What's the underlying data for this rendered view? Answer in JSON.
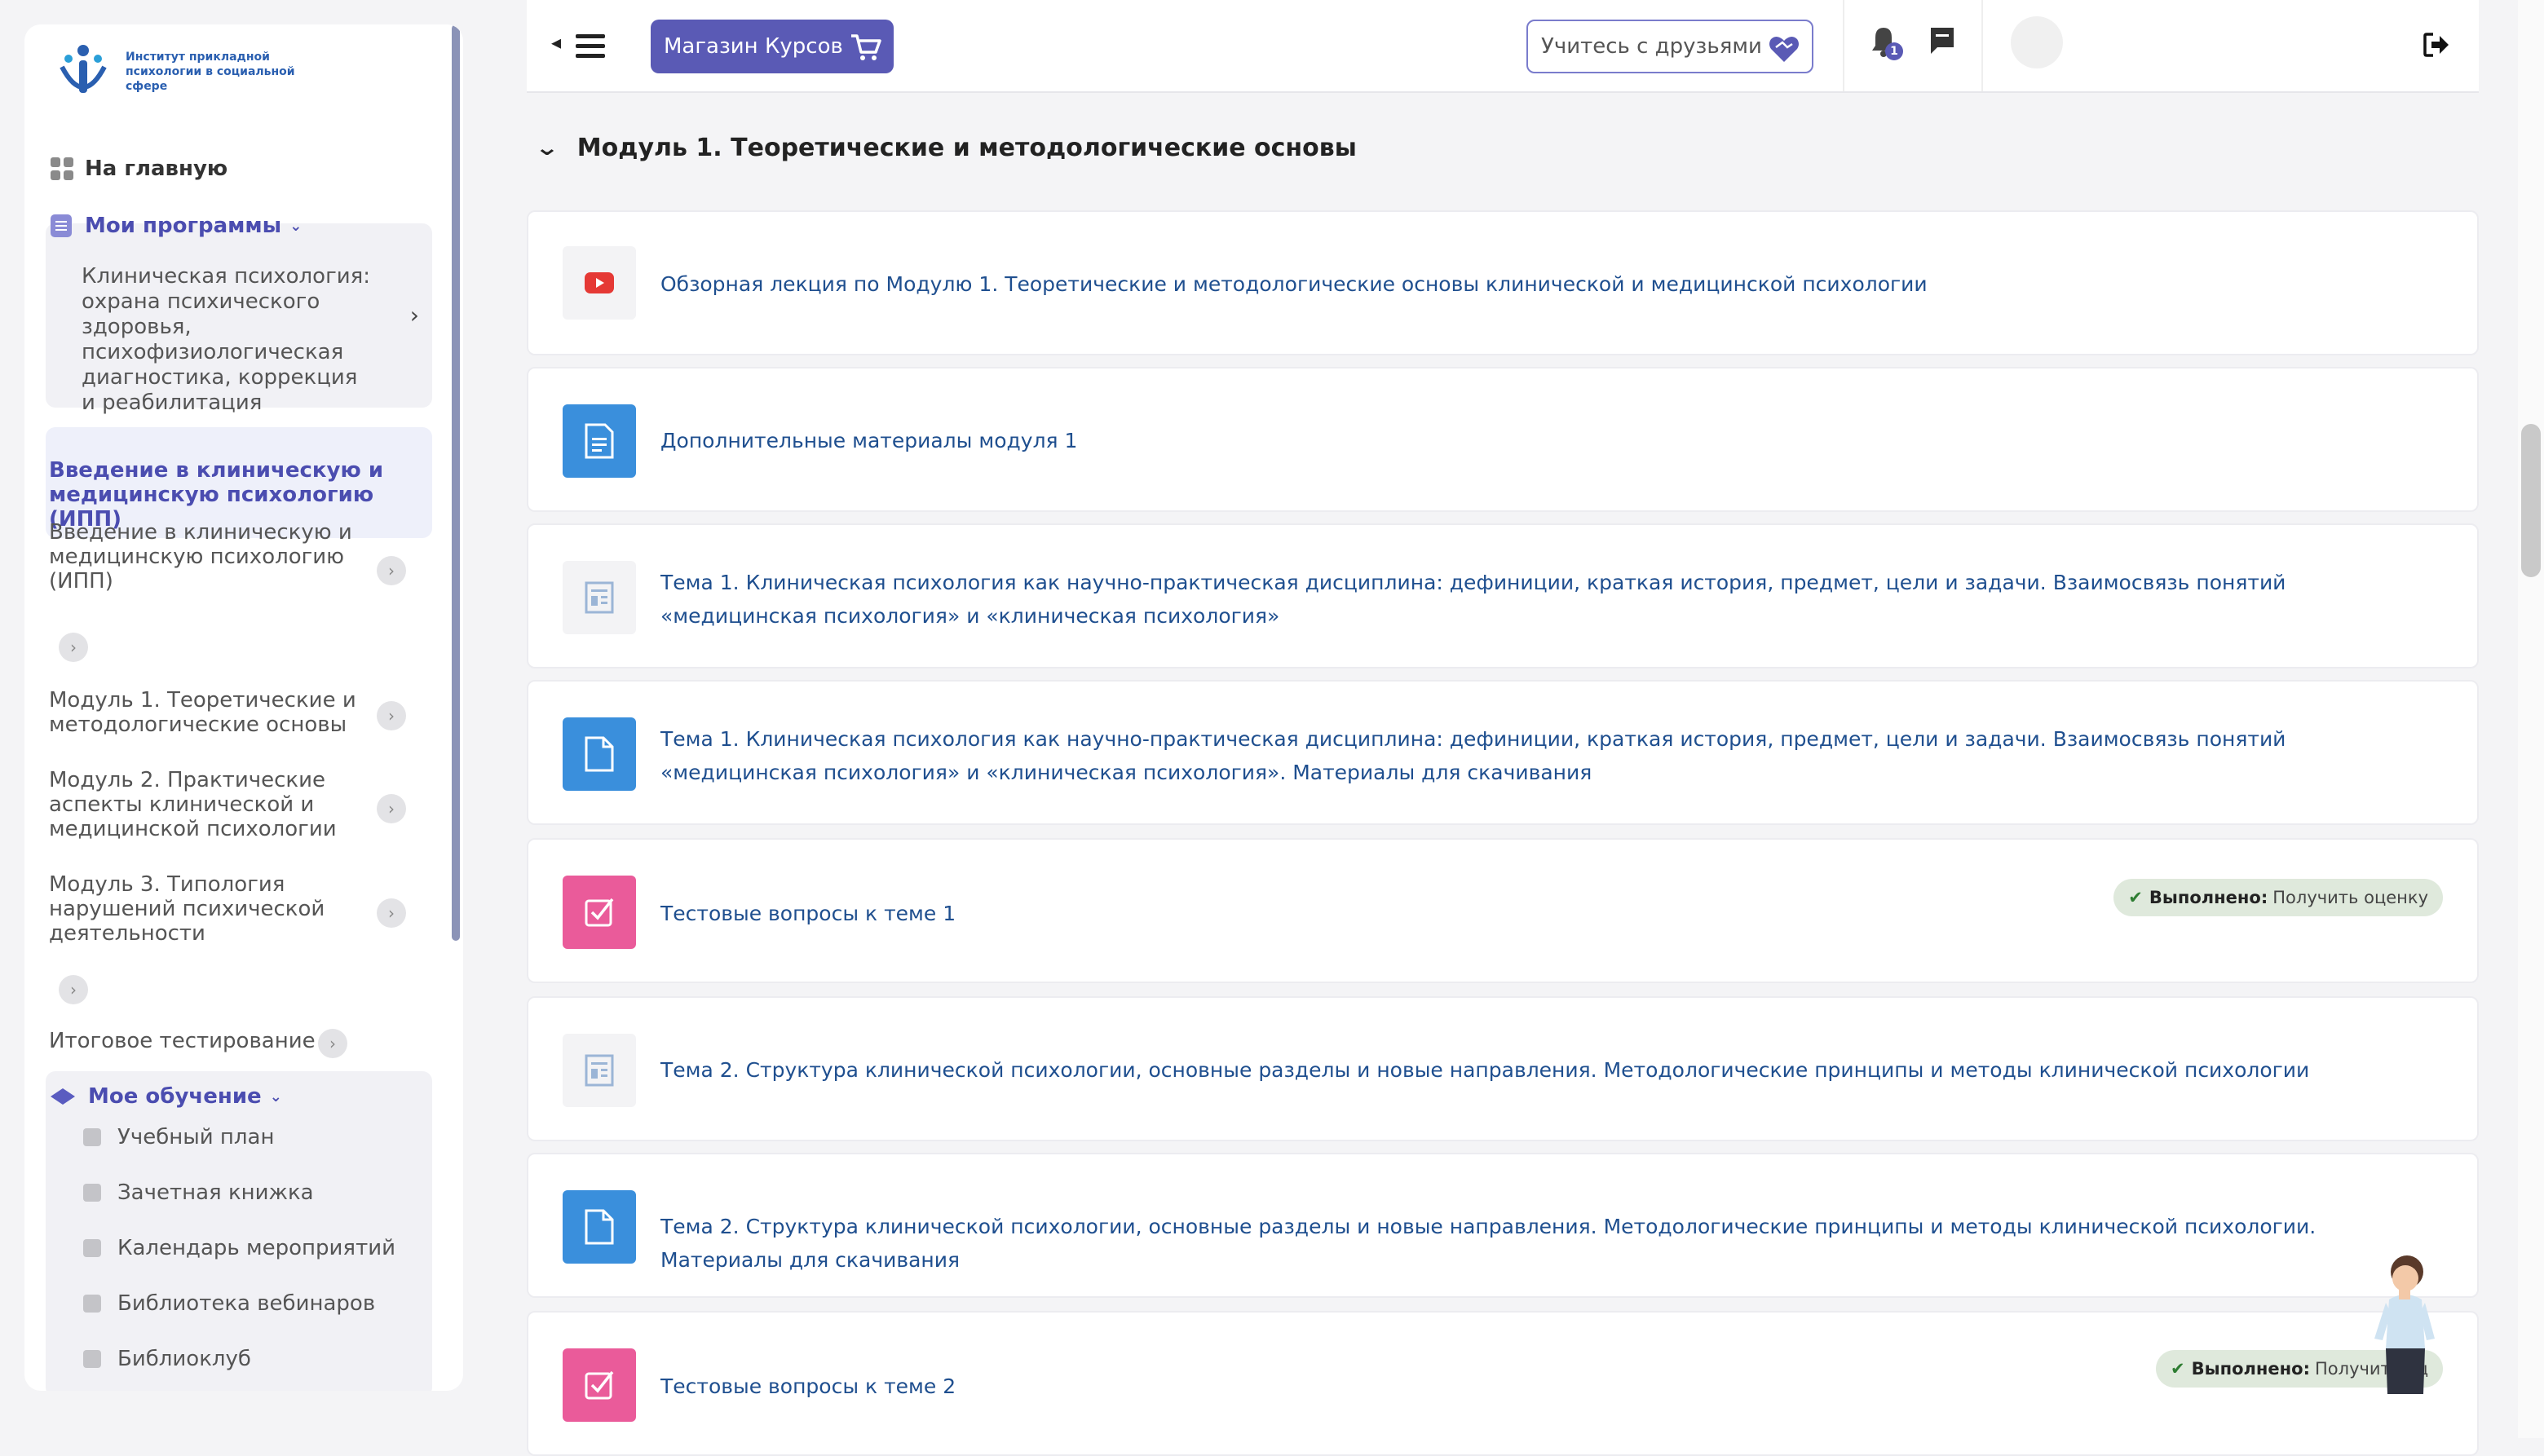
{
  "sidebar": {
    "logo_text": "Институт прикладной психологии в социальной сфере",
    "home_label": "На главную",
    "programs_label": "Мои программы",
    "program_title": "Клиническая психология: охрана психического здоровья, психофизиологическая диагностика, коррекция и реабилитация",
    "active_course": "Введение в клиническую и медицинскую психологию (ИПП)",
    "items": [
      {
        "label": "Введение в клиническую и медицинскую психологию (ИПП)"
      },
      {
        "label": "Модуль 1. Теоретические и методологические основы"
      },
      {
        "label": "Модуль 2. Практические аспекты клинической и медицинской психологии"
      },
      {
        "label": "Модуль 3. Типология нарушений психической деятельности"
      },
      {
        "label": "Итоговое тестирование"
      }
    ],
    "learning_label": "Мое обучение",
    "learning_items": [
      {
        "label": "Учебный план"
      },
      {
        "label": "Зачетная книжка"
      },
      {
        "label": "Календарь мероприятий"
      },
      {
        "label": "Библиотека вебинаров"
      },
      {
        "label": "Библиоклуб"
      }
    ]
  },
  "topbar": {
    "shop_label": "Магазин Курсов",
    "friends_label": "Учитесь с друзьями",
    "notification_count": "1"
  },
  "module": {
    "title": "Модуль 1. Теоретические и методологические основы",
    "activities": [
      {
        "title": "Обзорная лекция по Модулю 1. Теоретические и методологические основы клинической и медицинской психологии",
        "icon": "video-icon"
      },
      {
        "title": "Дополнительные материалы модуля 1",
        "icon": "document-icon"
      },
      {
        "title": "Тема 1. Клиническая психология как научно-практическая дисциплина: дефиниции, краткая история, предмет, цели и задачи. Взаимосвязь понятий «медицинская психология» и «клиническая психология»",
        "icon": "page-icon"
      },
      {
        "title": "Тема 1. Клиническая психология как научно-практическая дисциплина: дефиниции, краткая история, предмет, цели и задачи. Взаимосвязь понятий «медицинская психология» и «клиническая психология». Материалы для скачивания",
        "icon": "file-icon"
      },
      {
        "title": "Тестовые вопросы к теме 1",
        "icon": "quiz-icon",
        "status_label": "Выполнено:",
        "status_text": "Получить оценку"
      },
      {
        "title": "Тема 2. Структура клинической психологии, основные разделы и новые направления. Методологические принципы и методы клинической психологии",
        "icon": "page-icon"
      },
      {
        "title": "Тема 2. Структура клинической психологии, основные разделы и новые направления. Методологические принципы и методы клинической психологии. Материалы для скачивания",
        "icon": "file-icon"
      },
      {
        "title": "Тестовые вопросы к теме 2",
        "icon": "quiz-icon",
        "status_label": "Выполнено:",
        "status_text": "Получить оц"
      }
    ]
  },
  "colors": {
    "accent": "#5a5ab5",
    "link": "#1f4f8f",
    "video": "#e53935",
    "file": "#3a8fdc",
    "quiz": "#ea5b9a",
    "done_bg": "#dfe9dc"
  }
}
